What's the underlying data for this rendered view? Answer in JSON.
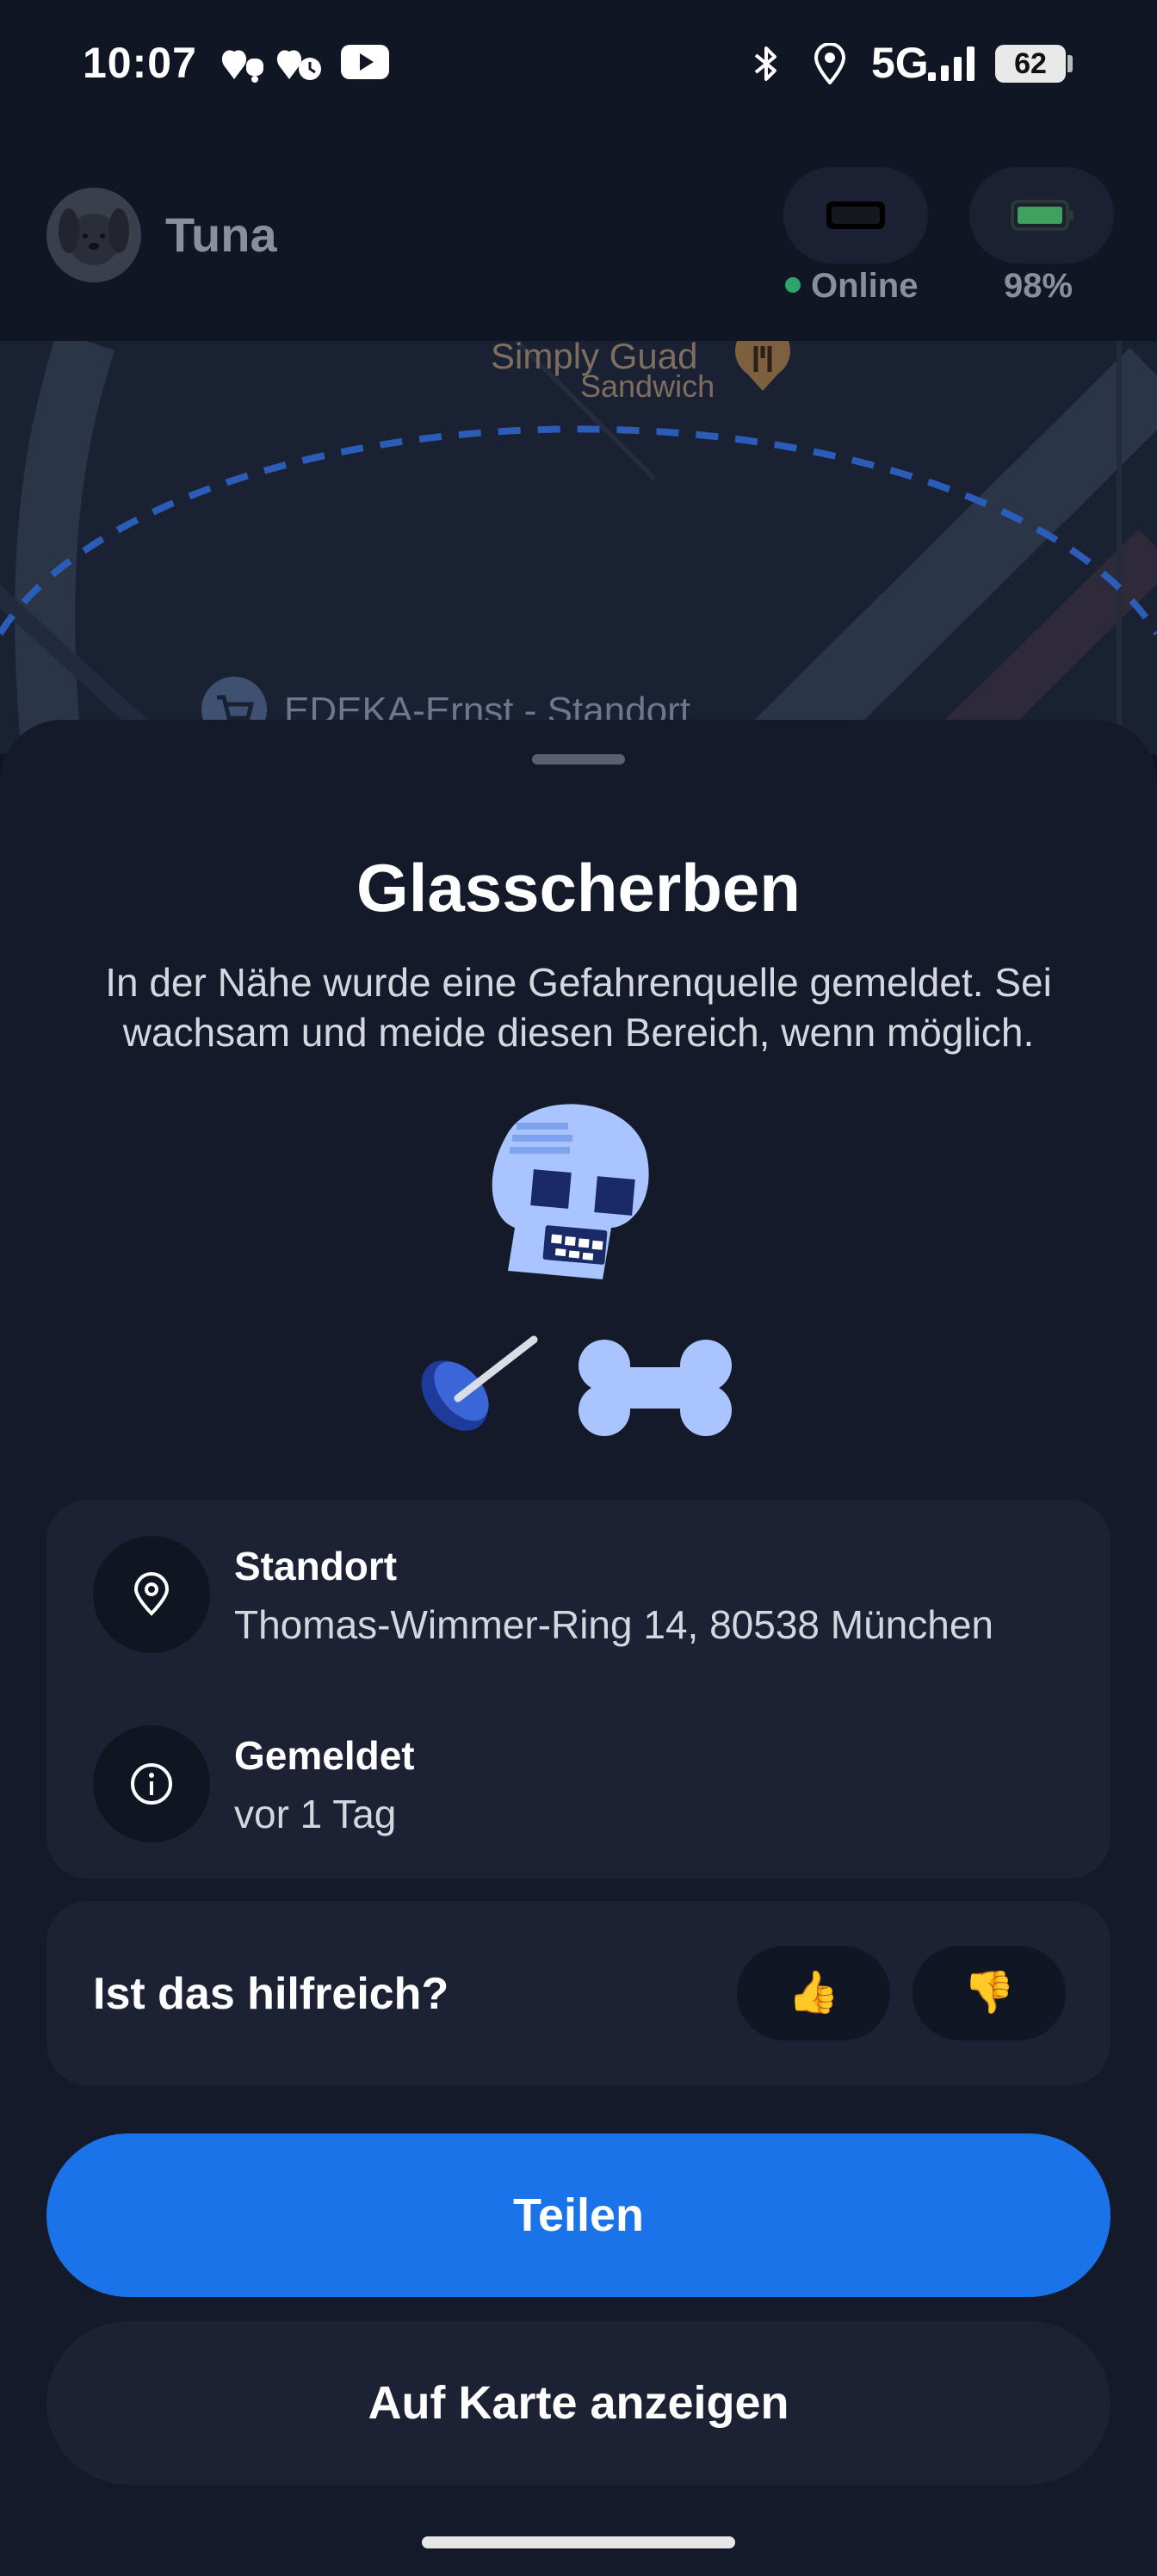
{
  "status_bar": {
    "time": "10:07",
    "network": "5G",
    "battery": "62"
  },
  "header": {
    "pet_name": "Tuna",
    "tracker_status": "Online",
    "tracker_battery": "98%"
  },
  "map": {
    "poi_restaurant": "Simply Guad",
    "poi_restaurant_type": "Sandwich",
    "poi_store": "EDEKA-Ernst - Standort"
  },
  "hazard": {
    "title": "Glasscherben",
    "description": "In der Nähe wurde eine Gefahrenquelle gemeldet. Sei wachsam und meide diesen Bereich, wenn möglich."
  },
  "details": {
    "location_label": "Standort",
    "location_value": "Thomas-Wimmer-Ring 14, 80538 München",
    "reported_label": "Gemeldet",
    "reported_value": "vor 1 Tag"
  },
  "feedback": {
    "question": "Ist das hilfreich?",
    "up": "👍",
    "down": "👎"
  },
  "actions": {
    "share": "Teilen",
    "show_on_map": "Auf Karte anzeigen"
  },
  "colors": {
    "background": "#0f1422",
    "card": "#1c2133",
    "primary_button": "#1a73e8",
    "online_dot": "#2ea36a",
    "illustration": "#a9c4ff"
  },
  "icons": [
    "heart-bell-icon",
    "heart-clock-icon",
    "youtube-icon",
    "bluetooth-icon",
    "location-icon",
    "signal-icon",
    "battery-icon",
    "tracker-icon",
    "location-pin-icon",
    "info-icon"
  ]
}
